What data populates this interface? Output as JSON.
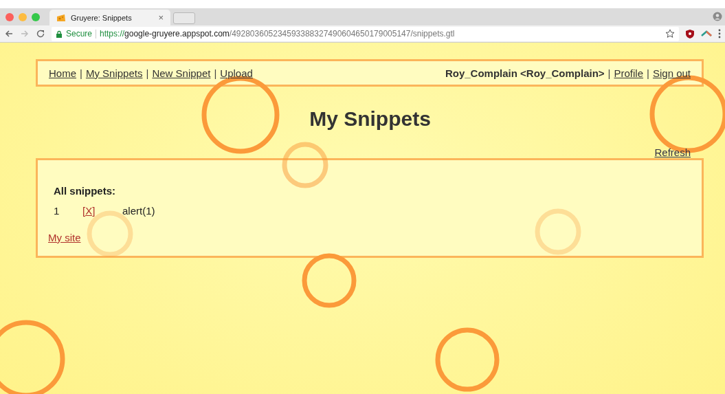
{
  "browser": {
    "tab": {
      "title": "Gruyere: Snippets",
      "close": "×"
    },
    "address": {
      "secure_label": "Secure",
      "url_scheme": "https://",
      "url_host": "google-gruyere.appspot.com",
      "url_path": "/492803605234593388327490604650179005147/snippets.gtl"
    }
  },
  "nav": {
    "links": [
      {
        "label": "Home"
      },
      {
        "label": "My Snippets",
        "separator": "|"
      },
      {
        "label": "New Snippet",
        "separator": "|"
      },
      {
        "label": "Upload",
        "separator": "|"
      }
    ],
    "user": "Roy_Complain <Roy_Complain>",
    "user_links": [
      {
        "label": "Profile",
        "separator": "|"
      },
      {
        "label": "Sign out",
        "separator": "|"
      }
    ]
  },
  "title": "My Snippets",
  "refresh": "Refresh",
  "section_heading": "All snippets:",
  "snippets": [
    {
      "number": "1",
      "delete": "[X]",
      "text": "alert(1)"
    }
  ],
  "footer_link": "My site"
}
